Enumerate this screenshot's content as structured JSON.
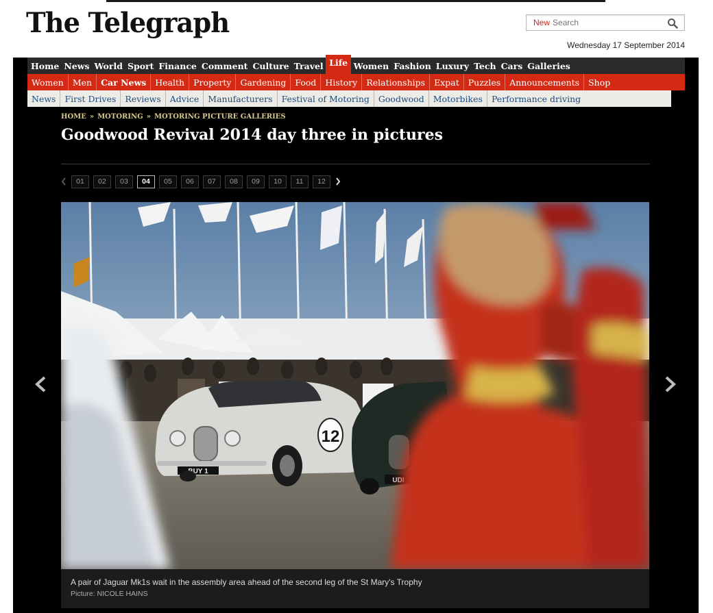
{
  "header": {
    "masthead": "The Telegraph",
    "search_new_label": "New",
    "search_placeholder": "Search",
    "date": "Wednesday 17 September 2014"
  },
  "nav_primary": [
    "Home",
    "News",
    "World",
    "Sport",
    "Finance",
    "Comment",
    "Culture",
    "Travel",
    "Life",
    "Women",
    "Fashion",
    "Luxury",
    "Tech",
    "Cars",
    "Galleries"
  ],
  "nav_primary_active": "Life",
  "nav_secondary": [
    "Women",
    "Men",
    "Car News",
    "Health",
    "Property",
    "Gardening",
    "Food",
    "History",
    "Relationships",
    "Expat",
    "Puzzles",
    "Announcements",
    "Shop"
  ],
  "nav_secondary_active": "Car News",
  "nav_tertiary": [
    "News",
    "First Drives",
    "Reviews",
    "Advice",
    "Manufacturers",
    "Festival of Motoring",
    "Goodwood",
    "Motorbikes",
    "Performance driving"
  ],
  "breadcrumb": {
    "items": [
      "HOME",
      "MOTORING",
      "MOTORING PICTURE GALLERIES"
    ],
    "separator": "»"
  },
  "article": {
    "title": "Goodwood Revival 2014 day three in pictures"
  },
  "pager": {
    "pages": [
      "01",
      "02",
      "03",
      "04",
      "05",
      "06",
      "07",
      "08",
      "09",
      "10",
      "11",
      "12"
    ],
    "current": "04"
  },
  "photo": {
    "plate_left": "BUY 1",
    "plate_right": "UDI",
    "race_number": "12",
    "caption": "A pair of Jaguar Mk1s wait in the assembly area ahead of the second leg of the St Mary's Trophy",
    "credit": "Picture: NICOLE HAINS"
  },
  "icons": {
    "search": "magnifier-icon",
    "prev_page": "chevron-left-icon",
    "next_page": "chevron-right-icon",
    "prev_photo": "chevron-left-large-icon",
    "next_photo": "chevron-right-large-icon"
  },
  "colors": {
    "brand_red": "#d42a14",
    "nav_dark": "#2a2a2a",
    "breadcrumb_gold": "#d8c98f",
    "link_blue": "#1a4b7d"
  }
}
